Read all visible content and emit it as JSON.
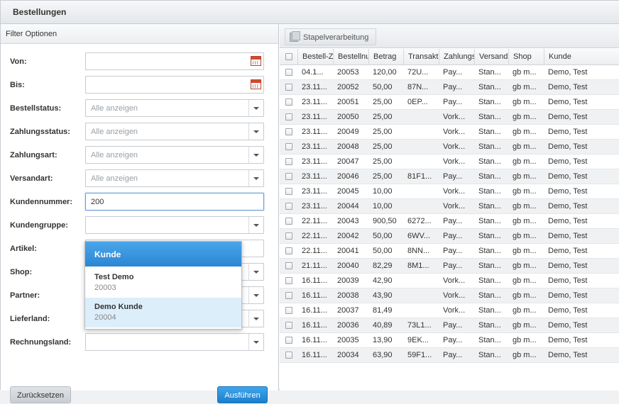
{
  "window": {
    "title": "Bestellungen"
  },
  "filter": {
    "title": "Filter Optionen",
    "fields": [
      {
        "label": "Von:",
        "type": "date",
        "value": "",
        "placeholder": ""
      },
      {
        "label": "Bis:",
        "type": "date",
        "value": "",
        "placeholder": ""
      },
      {
        "label": "Bestellstatus:",
        "type": "select",
        "value": "",
        "placeholder": "Alle anzeigen"
      },
      {
        "label": "Zahlungsstatus:",
        "type": "select",
        "value": "",
        "placeholder": "Alle anzeigen"
      },
      {
        "label": "Zahlungsart:",
        "type": "select",
        "value": "",
        "placeholder": "Alle anzeigen"
      },
      {
        "label": "Versandart:",
        "type": "select",
        "value": "",
        "placeholder": "Alle anzeigen"
      },
      {
        "label": "Kundennummer:",
        "type": "text",
        "value": "200",
        "placeholder": ""
      },
      {
        "label": "Kundengruppe:",
        "type": "select",
        "value": "",
        "placeholder": ""
      },
      {
        "label": "Artikel:",
        "type": "text",
        "value": "",
        "placeholder": ""
      },
      {
        "label": "Shop:",
        "type": "select",
        "value": "",
        "placeholder": ""
      },
      {
        "label": "Partner:",
        "type": "select",
        "value": "",
        "placeholder": ""
      },
      {
        "label": "Lieferland:",
        "type": "select",
        "value": "",
        "placeholder": ""
      },
      {
        "label": "Rechnungsland:",
        "type": "select",
        "value": "",
        "placeholder": ""
      }
    ],
    "reset_label": "Zurücksetzen",
    "run_label": "Ausführen"
  },
  "autocomplete": {
    "header": "Kunde",
    "items": [
      {
        "name": "Test Demo",
        "number": "20003",
        "selected": false
      },
      {
        "name": "Demo Kunde",
        "number": "20004",
        "selected": true
      }
    ]
  },
  "toolbar": {
    "batch_label": "Stapelverarbeitung"
  },
  "table": {
    "columns": [
      "Bestell-Z",
      "Bestellnu",
      "Betrag",
      "Transakt",
      "Zahlungs",
      "Versand",
      "Shop",
      "Kunde"
    ],
    "rows": [
      [
        "04.1...",
        "20053",
        "120,00",
        "72U...",
        "Pay...",
        "Stan...",
        "gb m...",
        "Demo, Test"
      ],
      [
        "23.11...",
        "20052",
        "50,00",
        "87N...",
        "Pay...",
        "Stan...",
        "gb m...",
        "Demo, Test"
      ],
      [
        "23.11...",
        "20051",
        "25,00",
        "0EP...",
        "Pay...",
        "Stan...",
        "gb m...",
        "Demo, Test"
      ],
      [
        "23.11...",
        "20050",
        "25,00",
        "",
        "Vork...",
        "Stan...",
        "gb m...",
        "Demo, Test"
      ],
      [
        "23.11...",
        "20049",
        "25,00",
        "",
        "Vork...",
        "Stan...",
        "gb m...",
        "Demo, Test"
      ],
      [
        "23.11...",
        "20048",
        "25,00",
        "",
        "Vork...",
        "Stan...",
        "gb m...",
        "Demo, Test"
      ],
      [
        "23.11...",
        "20047",
        "25,00",
        "",
        "Vork...",
        "Stan...",
        "gb m...",
        "Demo, Test"
      ],
      [
        "23.11...",
        "20046",
        "25,00",
        "81F1...",
        "Pay...",
        "Stan...",
        "gb m...",
        "Demo, Test"
      ],
      [
        "23.11...",
        "20045",
        "10,00",
        "",
        "Vork...",
        "Stan...",
        "gb m...",
        "Demo, Test"
      ],
      [
        "23.11...",
        "20044",
        "10,00",
        "",
        "Vork...",
        "Stan...",
        "gb m...",
        "Demo, Test"
      ],
      [
        "22.11...",
        "20043",
        "900,50",
        "6272...",
        "Pay...",
        "Stan...",
        "gb m...",
        "Demo, Test"
      ],
      [
        "22.11...",
        "20042",
        "50,00",
        "6WV...",
        "Pay...",
        "Stan...",
        "gb m...",
        "Demo, Test"
      ],
      [
        "22.11...",
        "20041",
        "50,00",
        "8NN...",
        "Pay...",
        "Stan...",
        "gb m...",
        "Demo, Test"
      ],
      [
        "21.11...",
        "20040",
        "82,29",
        "8M1...",
        "Pay...",
        "Stan...",
        "gb m...",
        "Demo, Test"
      ],
      [
        "16.11...",
        "20039",
        "42,90",
        "",
        "Vork...",
        "Stan...",
        "gb m...",
        "Demo, Test"
      ],
      [
        "16.11...",
        "20038",
        "43,90",
        "",
        "Vork...",
        "Stan...",
        "gb m...",
        "Demo, Test"
      ],
      [
        "16.11...",
        "20037",
        "81,49",
        "",
        "Vork...",
        "Stan...",
        "gb m...",
        "Demo, Test"
      ],
      [
        "16.11...",
        "20036",
        "40,89",
        "73L1...",
        "Pay...",
        "Stan...",
        "gb m...",
        "Demo, Test"
      ],
      [
        "16.11...",
        "20035",
        "13,90",
        "9EK...",
        "Pay...",
        "Stan...",
        "gb m...",
        "Demo, Test"
      ],
      [
        "16.11...",
        "20034",
        "63,90",
        "59F1...",
        "Pay...",
        "Stan...",
        "gb m...",
        "Demo, Test"
      ]
    ]
  }
}
